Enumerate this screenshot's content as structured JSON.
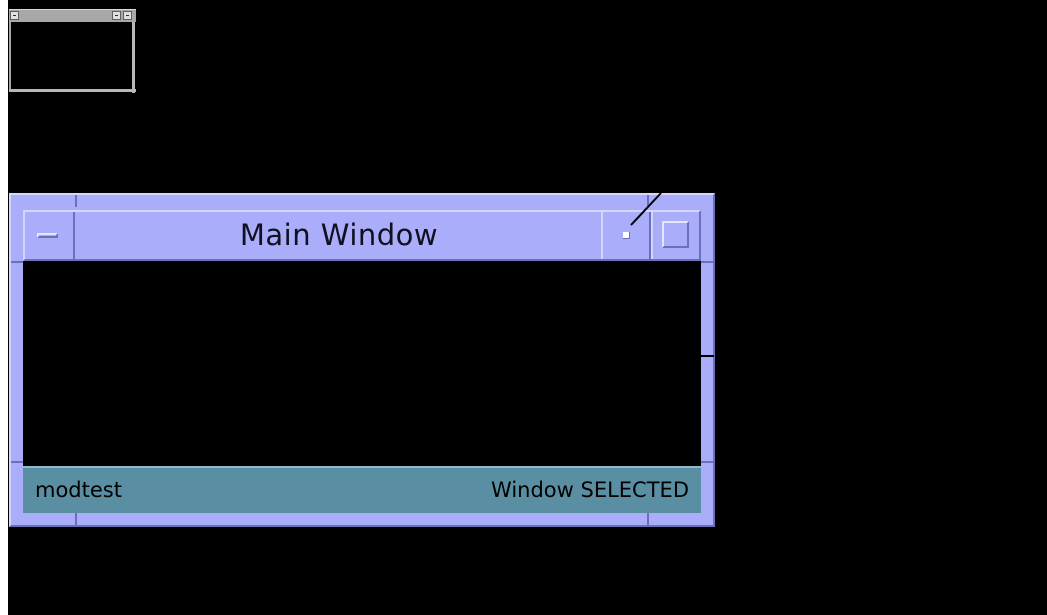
{
  "mini_window": {
    "menu_icon": "window-menu-icon",
    "minimize_icon": "minimize-icon",
    "maximize_icon": "maximize-icon"
  },
  "main_window": {
    "title": "Main Window",
    "menu_icon": "window-menu-icon",
    "minimize_icon": "minimize-icon",
    "maximize_icon": "maximize-icon",
    "status_left": "modtest",
    "status_right": "Window SELECTED"
  },
  "colors": {
    "desktop": "#000000",
    "window_frame": "#a9adfa",
    "status_bar": "#5a8fa3",
    "mini_window_frame": "#a8a8a8"
  }
}
